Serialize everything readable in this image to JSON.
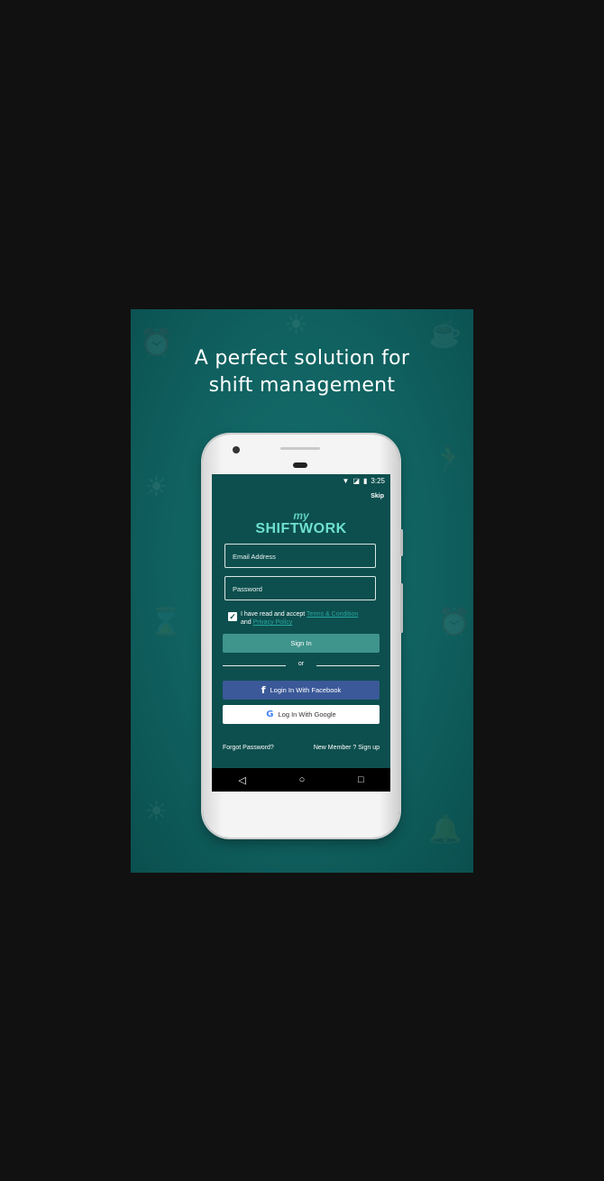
{
  "headline": {
    "line1": "A perfect solution for",
    "line2": "shift management"
  },
  "status_bar": {
    "time": "3:25",
    "icons": [
      "wifi-icon",
      "signal-icon",
      "battery-icon"
    ]
  },
  "skip_label": "Skip",
  "logo": {
    "my": "my",
    "main": "SHIFTWORK"
  },
  "form": {
    "email_placeholder": "Email Address",
    "password_placeholder": "Password",
    "terms_prefix": "I have read and accept ",
    "terms_link": "Terms & Condition",
    "terms_and": "and ",
    "privacy_link": "Privacy Policy",
    "checked": true
  },
  "buttons": {
    "sign_in": "Sign In",
    "or": "or",
    "facebook": "Login In With Facebook",
    "google": "Log In With Google"
  },
  "footer": {
    "forgot": "Forgot Password?",
    "signup": "New Member ? Sign up"
  },
  "colors": {
    "background": "#111111",
    "banner": "#0f5f5e",
    "screen": "#0d4f4e",
    "sign_in_button": "#3f948c",
    "facebook": "#3b5998",
    "link": "#27a7a0"
  }
}
